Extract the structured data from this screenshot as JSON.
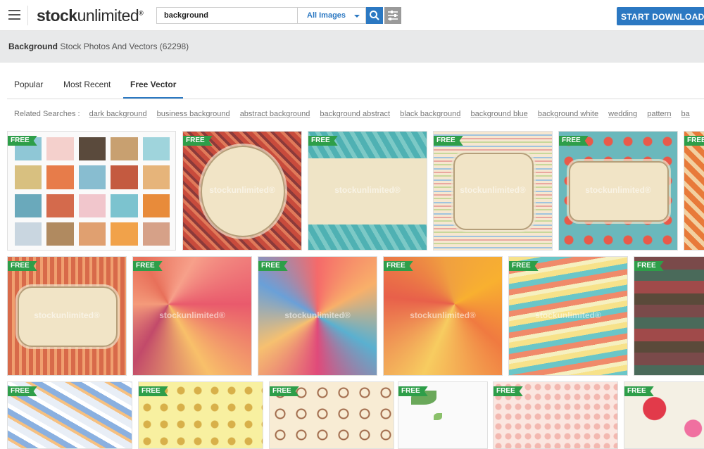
{
  "header": {
    "logo_strong": "stock",
    "logo_light": "unlimited",
    "logo_tm": "®",
    "search_value": "background",
    "search_scope": "All Images",
    "cta_label": "START DOWNLOADING",
    "accent": "#2b78c2"
  },
  "results": {
    "keyword": "Background",
    "suffix": "Stock Photos And Vectors",
    "count": "(62298)"
  },
  "tabs": [
    {
      "label": "Popular"
    },
    {
      "label": "Most Recent"
    },
    {
      "label": "Free Vector",
      "active": true
    }
  ],
  "related": {
    "label": "Related Searches",
    "colon": ":",
    "items": [
      "dark background",
      "business background",
      "abstract background",
      "background abstract",
      "black background",
      "background blue",
      "background white",
      "wedding",
      "pattern",
      "ba"
    ]
  },
  "badge": "FREE",
  "watermark": "stockunlimited®",
  "free_color": "#2e9e49"
}
